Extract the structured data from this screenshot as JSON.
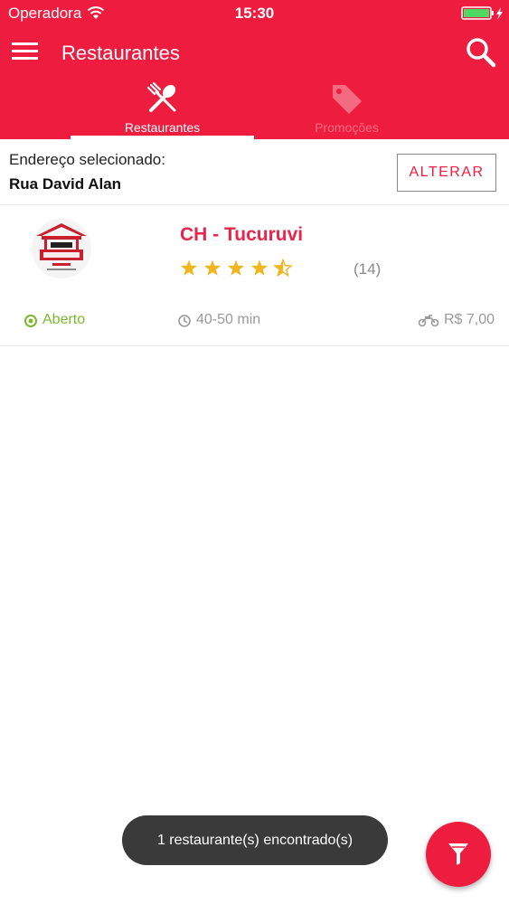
{
  "status_bar": {
    "carrier": "Operadora",
    "time": "15:30"
  },
  "nav": {
    "title": "Restaurantes"
  },
  "tabs": [
    {
      "label": "Restaurantes",
      "icon": "fork-spoon-icon",
      "active": true
    },
    {
      "label": "Promoções",
      "icon": "tag-icon",
      "active": false
    }
  ],
  "address": {
    "label": "Endereço selecionado:",
    "value": "Rua David Alan",
    "change_button": "ALTERAR"
  },
  "restaurant": {
    "name": "CH - Tucuruvi",
    "rating": 4.5,
    "rating_max": 5,
    "reviews": "(14)",
    "status": "Aberto",
    "delivery_time": "40-50 min",
    "delivery_fee": "R$ 7,00"
  },
  "toast": {
    "message": "1 restaurante(s) encontrado(s)"
  },
  "colors": {
    "primary": "#ee1c3e",
    "open": "#7cb82f",
    "star": "#f2b51b"
  }
}
